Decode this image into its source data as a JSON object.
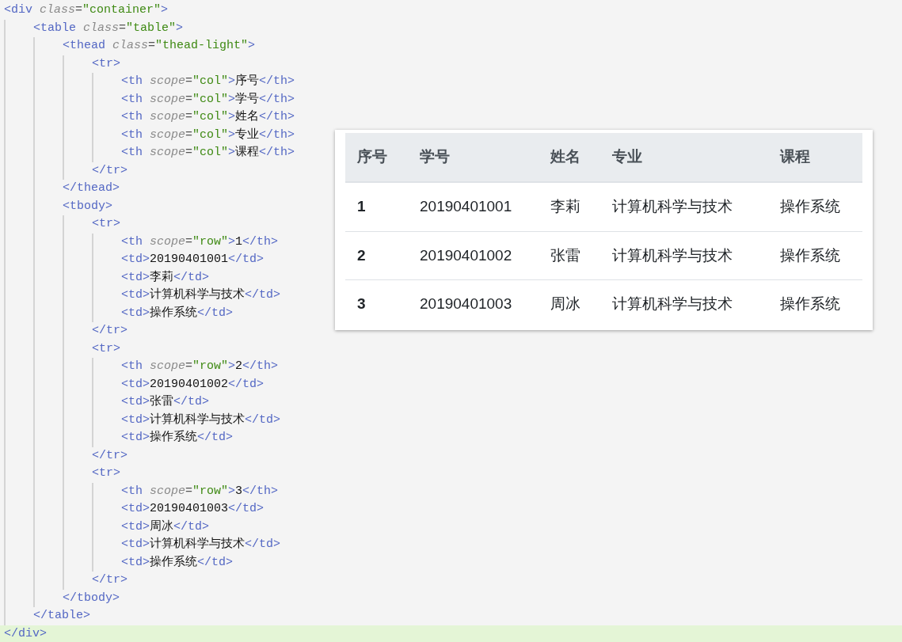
{
  "code": [
    {
      "line": [
        {
          "kind": "tag",
          "text": "<div"
        },
        {
          "kind": "attr",
          "text": " class"
        },
        {
          "kind": "eq",
          "text": "="
        },
        {
          "kind": "string",
          "text": "\"container\""
        },
        {
          "kind": "tag",
          "text": ">"
        }
      ],
      "current": false,
      "children": [
        {
          "line": [
            {
              "kind": "tag",
              "text": "<table"
            },
            {
              "kind": "attr",
              "text": " class"
            },
            {
              "kind": "eq",
              "text": "="
            },
            {
              "kind": "string",
              "text": "\"table\""
            },
            {
              "kind": "tag",
              "text": ">"
            }
          ],
          "children": [
            {
              "line": [
                {
                  "kind": "tag",
                  "text": "<thead"
                },
                {
                  "kind": "attr",
                  "text": " class"
                },
                {
                  "kind": "eq",
                  "text": "="
                },
                {
                  "kind": "string",
                  "text": "\"thead-light\""
                },
                {
                  "kind": "tag",
                  "text": ">"
                }
              ],
              "children": [
                {
                  "line": [
                    {
                      "kind": "tag",
                      "text": "<tr>"
                    }
                  ],
                  "children": [
                    {
                      "line": [
                        {
                          "kind": "tag",
                          "text": "<th"
                        },
                        {
                          "kind": "attr",
                          "text": " scope"
                        },
                        {
                          "kind": "eq",
                          "text": "="
                        },
                        {
                          "kind": "string",
                          "text": "\"col\""
                        },
                        {
                          "kind": "tag",
                          "text": ">"
                        },
                        {
                          "kind": "text",
                          "text": "序号"
                        },
                        {
                          "kind": "tag",
                          "text": "</th>"
                        }
                      ]
                    },
                    {
                      "line": [
                        {
                          "kind": "tag",
                          "text": "<th"
                        },
                        {
                          "kind": "attr",
                          "text": " scope"
                        },
                        {
                          "kind": "eq",
                          "text": "="
                        },
                        {
                          "kind": "string",
                          "text": "\"col\""
                        },
                        {
                          "kind": "tag",
                          "text": ">"
                        },
                        {
                          "kind": "text",
                          "text": "学号"
                        },
                        {
                          "kind": "tag",
                          "text": "</th>"
                        }
                      ]
                    },
                    {
                      "line": [
                        {
                          "kind": "tag",
                          "text": "<th"
                        },
                        {
                          "kind": "attr",
                          "text": " scope"
                        },
                        {
                          "kind": "eq",
                          "text": "="
                        },
                        {
                          "kind": "string",
                          "text": "\"col\""
                        },
                        {
                          "kind": "tag",
                          "text": ">"
                        },
                        {
                          "kind": "text",
                          "text": "姓名"
                        },
                        {
                          "kind": "tag",
                          "text": "</th>"
                        }
                      ]
                    },
                    {
                      "line": [
                        {
                          "kind": "tag",
                          "text": "<th"
                        },
                        {
                          "kind": "attr",
                          "text": " scope"
                        },
                        {
                          "kind": "eq",
                          "text": "="
                        },
                        {
                          "kind": "string",
                          "text": "\"col\""
                        },
                        {
                          "kind": "tag",
                          "text": ">"
                        },
                        {
                          "kind": "text",
                          "text": "专业"
                        },
                        {
                          "kind": "tag",
                          "text": "</th>"
                        }
                      ]
                    },
                    {
                      "line": [
                        {
                          "kind": "tag",
                          "text": "<th"
                        },
                        {
                          "kind": "attr",
                          "text": " scope"
                        },
                        {
                          "kind": "eq",
                          "text": "="
                        },
                        {
                          "kind": "string",
                          "text": "\"col\""
                        },
                        {
                          "kind": "tag",
                          "text": ">"
                        },
                        {
                          "kind": "text",
                          "text": "课程"
                        },
                        {
                          "kind": "tag",
                          "text": "</th>"
                        }
                      ]
                    }
                  ]
                },
                {
                  "line": [
                    {
                      "kind": "tag",
                      "text": "</tr>"
                    }
                  ]
                }
              ]
            },
            {
              "line": [
                {
                  "kind": "tag",
                  "text": "</thead>"
                }
              ]
            },
            {
              "line": [
                {
                  "kind": "tag",
                  "text": "<tbody>"
                }
              ],
              "children": [
                {
                  "line": [
                    {
                      "kind": "tag",
                      "text": "<tr>"
                    }
                  ],
                  "children": [
                    {
                      "line": [
                        {
                          "kind": "tag",
                          "text": "<th"
                        },
                        {
                          "kind": "attr",
                          "text": " scope"
                        },
                        {
                          "kind": "eq",
                          "text": "="
                        },
                        {
                          "kind": "string",
                          "text": "\"row\""
                        },
                        {
                          "kind": "tag",
                          "text": ">"
                        },
                        {
                          "kind": "text",
                          "text": "1"
                        },
                        {
                          "kind": "tag",
                          "text": "</th>"
                        }
                      ]
                    },
                    {
                      "line": [
                        {
                          "kind": "tag",
                          "text": "<td>"
                        },
                        {
                          "kind": "text",
                          "text": "20190401001"
                        },
                        {
                          "kind": "tag",
                          "text": "</td>"
                        }
                      ]
                    },
                    {
                      "line": [
                        {
                          "kind": "tag",
                          "text": "<td>"
                        },
                        {
                          "kind": "text",
                          "text": "李莉"
                        },
                        {
                          "kind": "tag",
                          "text": "</td>"
                        }
                      ]
                    },
                    {
                      "line": [
                        {
                          "kind": "tag",
                          "text": "<td>"
                        },
                        {
                          "kind": "text",
                          "text": "计算机科学与技术"
                        },
                        {
                          "kind": "tag",
                          "text": "</td>"
                        }
                      ]
                    },
                    {
                      "line": [
                        {
                          "kind": "tag",
                          "text": "<td>"
                        },
                        {
                          "kind": "text",
                          "text": "操作系统"
                        },
                        {
                          "kind": "tag",
                          "text": "</td>"
                        }
                      ]
                    }
                  ]
                },
                {
                  "line": [
                    {
                      "kind": "tag",
                      "text": "</tr>"
                    }
                  ]
                },
                {
                  "line": [
                    {
                      "kind": "tag",
                      "text": "<tr>"
                    }
                  ],
                  "children": [
                    {
                      "line": [
                        {
                          "kind": "tag",
                          "text": "<th"
                        },
                        {
                          "kind": "attr",
                          "text": " scope"
                        },
                        {
                          "kind": "eq",
                          "text": "="
                        },
                        {
                          "kind": "string",
                          "text": "\"row\""
                        },
                        {
                          "kind": "tag",
                          "text": ">"
                        },
                        {
                          "kind": "text",
                          "text": "2"
                        },
                        {
                          "kind": "tag",
                          "text": "</th>"
                        }
                      ]
                    },
                    {
                      "line": [
                        {
                          "kind": "tag",
                          "text": "<td>"
                        },
                        {
                          "kind": "text",
                          "text": "20190401002"
                        },
                        {
                          "kind": "tag",
                          "text": "</td>"
                        }
                      ]
                    },
                    {
                      "line": [
                        {
                          "kind": "tag",
                          "text": "<td>"
                        },
                        {
                          "kind": "text",
                          "text": "张雷"
                        },
                        {
                          "kind": "tag",
                          "text": "</td>"
                        }
                      ]
                    },
                    {
                      "line": [
                        {
                          "kind": "tag",
                          "text": "<td>"
                        },
                        {
                          "kind": "text",
                          "text": "计算机科学与技术"
                        },
                        {
                          "kind": "tag",
                          "text": "</td>"
                        }
                      ]
                    },
                    {
                      "line": [
                        {
                          "kind": "tag",
                          "text": "<td>"
                        },
                        {
                          "kind": "text",
                          "text": "操作系统"
                        },
                        {
                          "kind": "tag",
                          "text": "</td>"
                        }
                      ]
                    }
                  ]
                },
                {
                  "line": [
                    {
                      "kind": "tag",
                      "text": "</tr>"
                    }
                  ]
                },
                {
                  "line": [
                    {
                      "kind": "tag",
                      "text": "<tr>"
                    }
                  ],
                  "children": [
                    {
                      "line": [
                        {
                          "kind": "tag",
                          "text": "<th"
                        },
                        {
                          "kind": "attr",
                          "text": " scope"
                        },
                        {
                          "kind": "eq",
                          "text": "="
                        },
                        {
                          "kind": "string",
                          "text": "\"row\""
                        },
                        {
                          "kind": "tag",
                          "text": ">"
                        },
                        {
                          "kind": "text",
                          "text": "3"
                        },
                        {
                          "kind": "tag",
                          "text": "</th>"
                        }
                      ]
                    },
                    {
                      "line": [
                        {
                          "kind": "tag",
                          "text": "<td>"
                        },
                        {
                          "kind": "text",
                          "text": "20190401003"
                        },
                        {
                          "kind": "tag",
                          "text": "</td>"
                        }
                      ]
                    },
                    {
                      "line": [
                        {
                          "kind": "tag",
                          "text": "<td>"
                        },
                        {
                          "kind": "text",
                          "text": "周冰"
                        },
                        {
                          "kind": "tag",
                          "text": "</td>"
                        }
                      ]
                    },
                    {
                      "line": [
                        {
                          "kind": "tag",
                          "text": "<td>"
                        },
                        {
                          "kind": "text",
                          "text": "计算机科学与技术"
                        },
                        {
                          "kind": "tag",
                          "text": "</td>"
                        }
                      ]
                    },
                    {
                      "line": [
                        {
                          "kind": "tag",
                          "text": "<td>"
                        },
                        {
                          "kind": "text",
                          "text": "操作系统"
                        },
                        {
                          "kind": "tag",
                          "text": "</td>"
                        }
                      ]
                    }
                  ]
                },
                {
                  "line": [
                    {
                      "kind": "tag",
                      "text": "</tr>"
                    }
                  ]
                }
              ]
            },
            {
              "line": [
                {
                  "kind": "tag",
                  "text": "</tbody>"
                }
              ]
            }
          ]
        },
        {
          "line": [
            {
              "kind": "tag",
              "text": "</table>"
            }
          ]
        }
      ]
    },
    {
      "line": [
        {
          "kind": "tag",
          "text": "</div>"
        }
      ],
      "current": true
    }
  ],
  "table": {
    "columns": [
      "序号",
      "学号",
      "姓名",
      "专业",
      "课程"
    ],
    "rows": [
      [
        "1",
        "20190401001",
        "李莉",
        "计算机科学与技术",
        "操作系统"
      ],
      [
        "2",
        "20190401002",
        "张雷",
        "计算机科学与技术",
        "操作系统"
      ],
      [
        "3",
        "20190401003",
        "周冰",
        "计算机科学与技术",
        "操作系统"
      ]
    ]
  }
}
